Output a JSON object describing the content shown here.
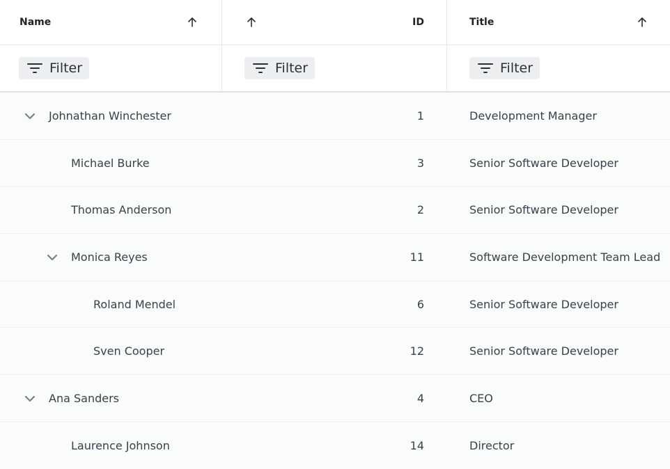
{
  "columns": {
    "name": {
      "label": "Name"
    },
    "id": {
      "label": "ID"
    },
    "title": {
      "label": "Title"
    }
  },
  "filter_label": "Filter",
  "icons": {
    "sort": "arrow-up-icon",
    "filter": "filter-icon",
    "expand": "chevron-down-icon"
  },
  "rows": [
    {
      "name": "Johnathan Winchester",
      "id": "1",
      "title": "Development Manager",
      "level": 0,
      "expandable": true
    },
    {
      "name": "Michael Burke",
      "id": "3",
      "title": "Senior Software Developer",
      "level": 1,
      "expandable": false
    },
    {
      "name": "Thomas Anderson",
      "id": "2",
      "title": "Senior Software Developer",
      "level": 1,
      "expandable": false
    },
    {
      "name": "Monica Reyes",
      "id": "11",
      "title": "Software Development Team Lead",
      "level": 1,
      "expandable": true
    },
    {
      "name": "Roland Mendel",
      "id": "6",
      "title": "Senior Software Developer",
      "level": 2,
      "expandable": false
    },
    {
      "name": "Sven Cooper",
      "id": "12",
      "title": "Senior Software Developer",
      "level": 2,
      "expandable": false
    },
    {
      "name": "Ana Sanders",
      "id": "4",
      "title": "CEO",
      "level": 0,
      "expandable": true
    },
    {
      "name": "Laurence Johnson",
      "id": "14",
      "title": "Director",
      "level": 1,
      "expandable": false
    }
  ]
}
